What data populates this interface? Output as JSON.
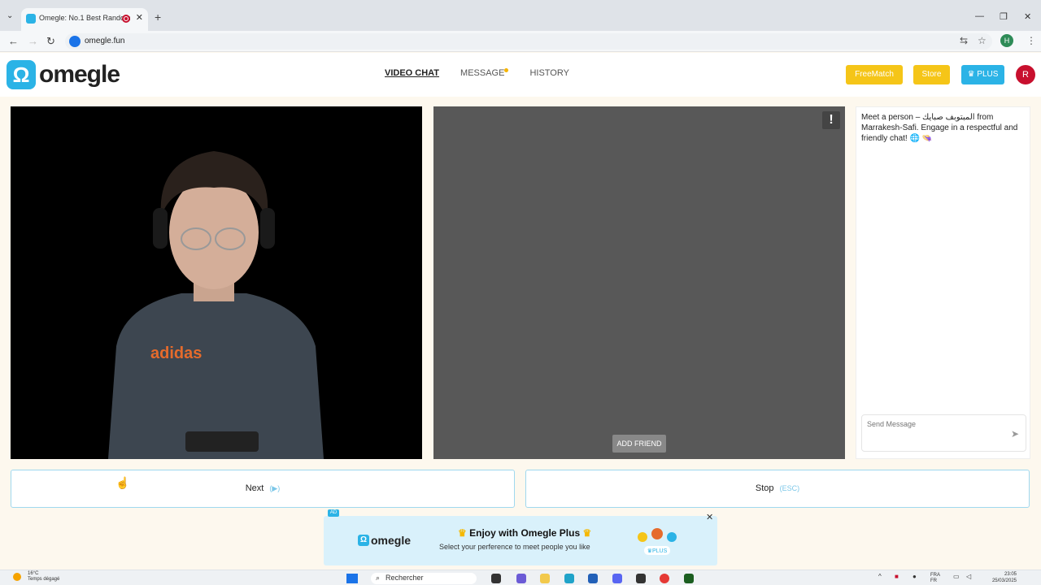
{
  "browser": {
    "tab_title": "Omegle: No.1 Best Random",
    "new_tab": "+",
    "url": "omegle.fun",
    "profile_initial": "H"
  },
  "site": {
    "logo_mark": "Ω",
    "logo_text": "omegle",
    "nav": {
      "video_chat": "VIDEO CHAT",
      "message": "MESSAGE",
      "history": "HISTORY"
    },
    "buttons": {
      "freematch": "FreeMatch",
      "store": "Store",
      "plus": "♛ PLUS"
    },
    "avatar_initial": "R"
  },
  "video": {
    "report_label": "!",
    "add_friend": "ADD FRIEND"
  },
  "chat": {
    "intro": "Meet a person – المبتوبف صبايك from Marrakesh-Safi. Engage in a respectful and friendly chat! 🌐 👒",
    "placeholder": "Send Message",
    "send_icon": "➤"
  },
  "controls": {
    "next_label": "Next",
    "next_hint": "(▶)",
    "stop_label": "Stop",
    "stop_hint": "(ESC)"
  },
  "ad": {
    "tag": "AD",
    "close": "✕",
    "logo_mark": "Ω",
    "logo_text": "omegle",
    "title": "Enjoy with Omegle Plus",
    "subtitle": "Select your perference to meet people you like",
    "badge": "♛PLUS"
  },
  "taskbar": {
    "temp": "16°C",
    "weather": "Temps dégagé",
    "search": "Rechercher",
    "lang_top": "FRA",
    "lang_bottom": "FR",
    "time": "23:05",
    "date": "25/03/2025"
  },
  "colors": {
    "brand_blue": "#2bb3e6",
    "accent_yellow": "#f5c518",
    "avatar_red": "#c8102e"
  }
}
